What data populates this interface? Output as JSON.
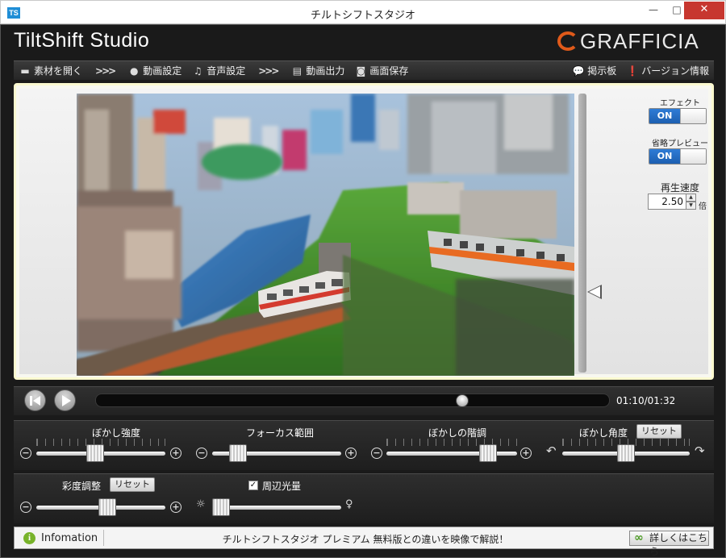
{
  "window": {
    "app_icon_text": "TS",
    "title": "チルトシフトスタジオ",
    "controls": {
      "minimize": "—",
      "maximize": "□",
      "close": "✕"
    }
  },
  "header": {
    "brand": "TiltShift Studio",
    "logo": "GRAFFICIA"
  },
  "toolbar": {
    "open_material": "素材を開く",
    "video_settings": "動画設定",
    "audio_settings": "音声設定",
    "video_output": "動画出力",
    "save_screen": "画面保存",
    "bulletin_board": "掲示板",
    "version_info": "バージョン情報",
    "step_arrow": ">>>"
  },
  "side_panel": {
    "effect_label": "エフェクト",
    "effect_state": "ON",
    "effect_on": true,
    "preview_label": "省略プレビュー",
    "preview_state": "ON",
    "preview_on": true,
    "speed_label": "再生速度",
    "speed_value": "2.50",
    "speed_unit": "倍"
  },
  "playback": {
    "timecode": "01:10/01:32",
    "progress": 0.72
  },
  "adjustments": {
    "blur_strength": {
      "label": "ぼかし強度",
      "value": 0.45
    },
    "focus_range": {
      "label": "フォーカス範囲",
      "value": 0.15
    },
    "blur_gradation": {
      "label": "ぼかしの階調",
      "value": 0.82
    },
    "blur_angle": {
      "label": "ぼかし角度",
      "value": 0.5,
      "reset": "リセット"
    },
    "saturation": {
      "label": "彩度調整",
      "value": 0.56,
      "reset": "リセット"
    },
    "vignette": {
      "label": "周辺光量",
      "checked": true,
      "value": 0.0
    }
  },
  "info": {
    "label": "Infomation",
    "message": "チルトシフトスタジオ プレミアム 無料版との違いを映像で解説！",
    "details_button": "詳しくはこちら"
  },
  "colors": {
    "accent_blue": "#2f7cd6",
    "close_red": "#c7372f",
    "logo_orange": "#e05a1a",
    "info_green": "#78b32a"
  }
}
